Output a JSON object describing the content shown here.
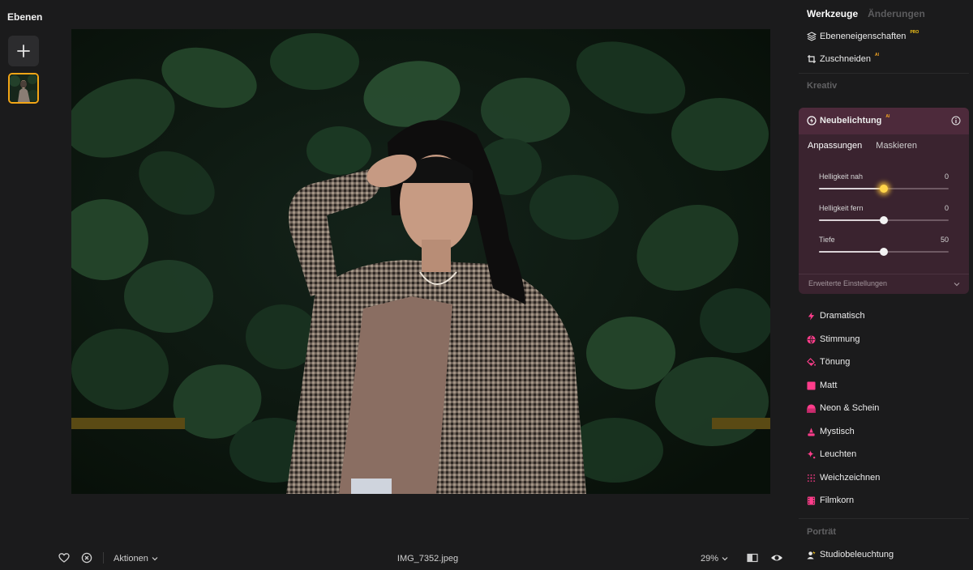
{
  "layers_panel": {
    "title": "Ebenen"
  },
  "right_panel": {
    "tabs": {
      "active": "Werkzeuge",
      "inactive": "Änderungen"
    },
    "tools_top": [
      {
        "label": "Ebeneneigenschaften",
        "badge": "PRO"
      },
      {
        "label": "Zuschneiden",
        "badge": "AI"
      }
    ],
    "section_kreativ": "Kreativ",
    "relight": {
      "title": "Neubelichtung",
      "badge": "AI",
      "subtabs": [
        "Anpassungen",
        "Maskieren"
      ],
      "sliders": [
        {
          "label": "Helligkeit nah",
          "value": "0",
          "level": 0.5
        },
        {
          "label": "Helligkeit fern",
          "value": "0",
          "level": 0.5
        },
        {
          "label": "Tiefe",
          "value": "50",
          "level": 0.5
        }
      ],
      "advanced": "Erweiterte Einstellungen"
    },
    "creative_tools": [
      {
        "label": "Dramatisch",
        "icon": "lightning-icon",
        "color": "#ff3d8b"
      },
      {
        "label": "Stimmung",
        "icon": "mood-icon",
        "color": "#ff3d8b"
      },
      {
        "label": "Tönung",
        "icon": "paint-bucket-icon",
        "color": "#ff3d8b"
      },
      {
        "label": "Matt",
        "icon": "square-icon",
        "color": "#ff3d8b"
      },
      {
        "label": "Neon & Schein",
        "icon": "neon-icon",
        "color": "#ff3d8b"
      },
      {
        "label": "Mystisch",
        "icon": "mystic-icon",
        "color": "#ff3d8b"
      },
      {
        "label": "Leuchten",
        "icon": "sparkle-icon",
        "color": "#ff3d8b"
      },
      {
        "label": "Weichzeichnen",
        "icon": "blur-icon",
        "color": "#ff3d8b"
      },
      {
        "label": "Filmkorn",
        "icon": "film-icon",
        "color": "#ff3d8b"
      }
    ],
    "section_portrait": "Porträt",
    "portrait_tools": [
      {
        "label": "Studiobeleuchtung",
        "icon": "studio-light-icon",
        "color": "#f5c518"
      }
    ]
  },
  "bottom_bar": {
    "actions_label": "Aktionen",
    "filename": "IMG_7352.jpeg",
    "zoom": "29%"
  },
  "colors": {
    "accent": "#ff3d8b",
    "thumb_border": "#f2a516",
    "card_bg": "#3a232f"
  }
}
